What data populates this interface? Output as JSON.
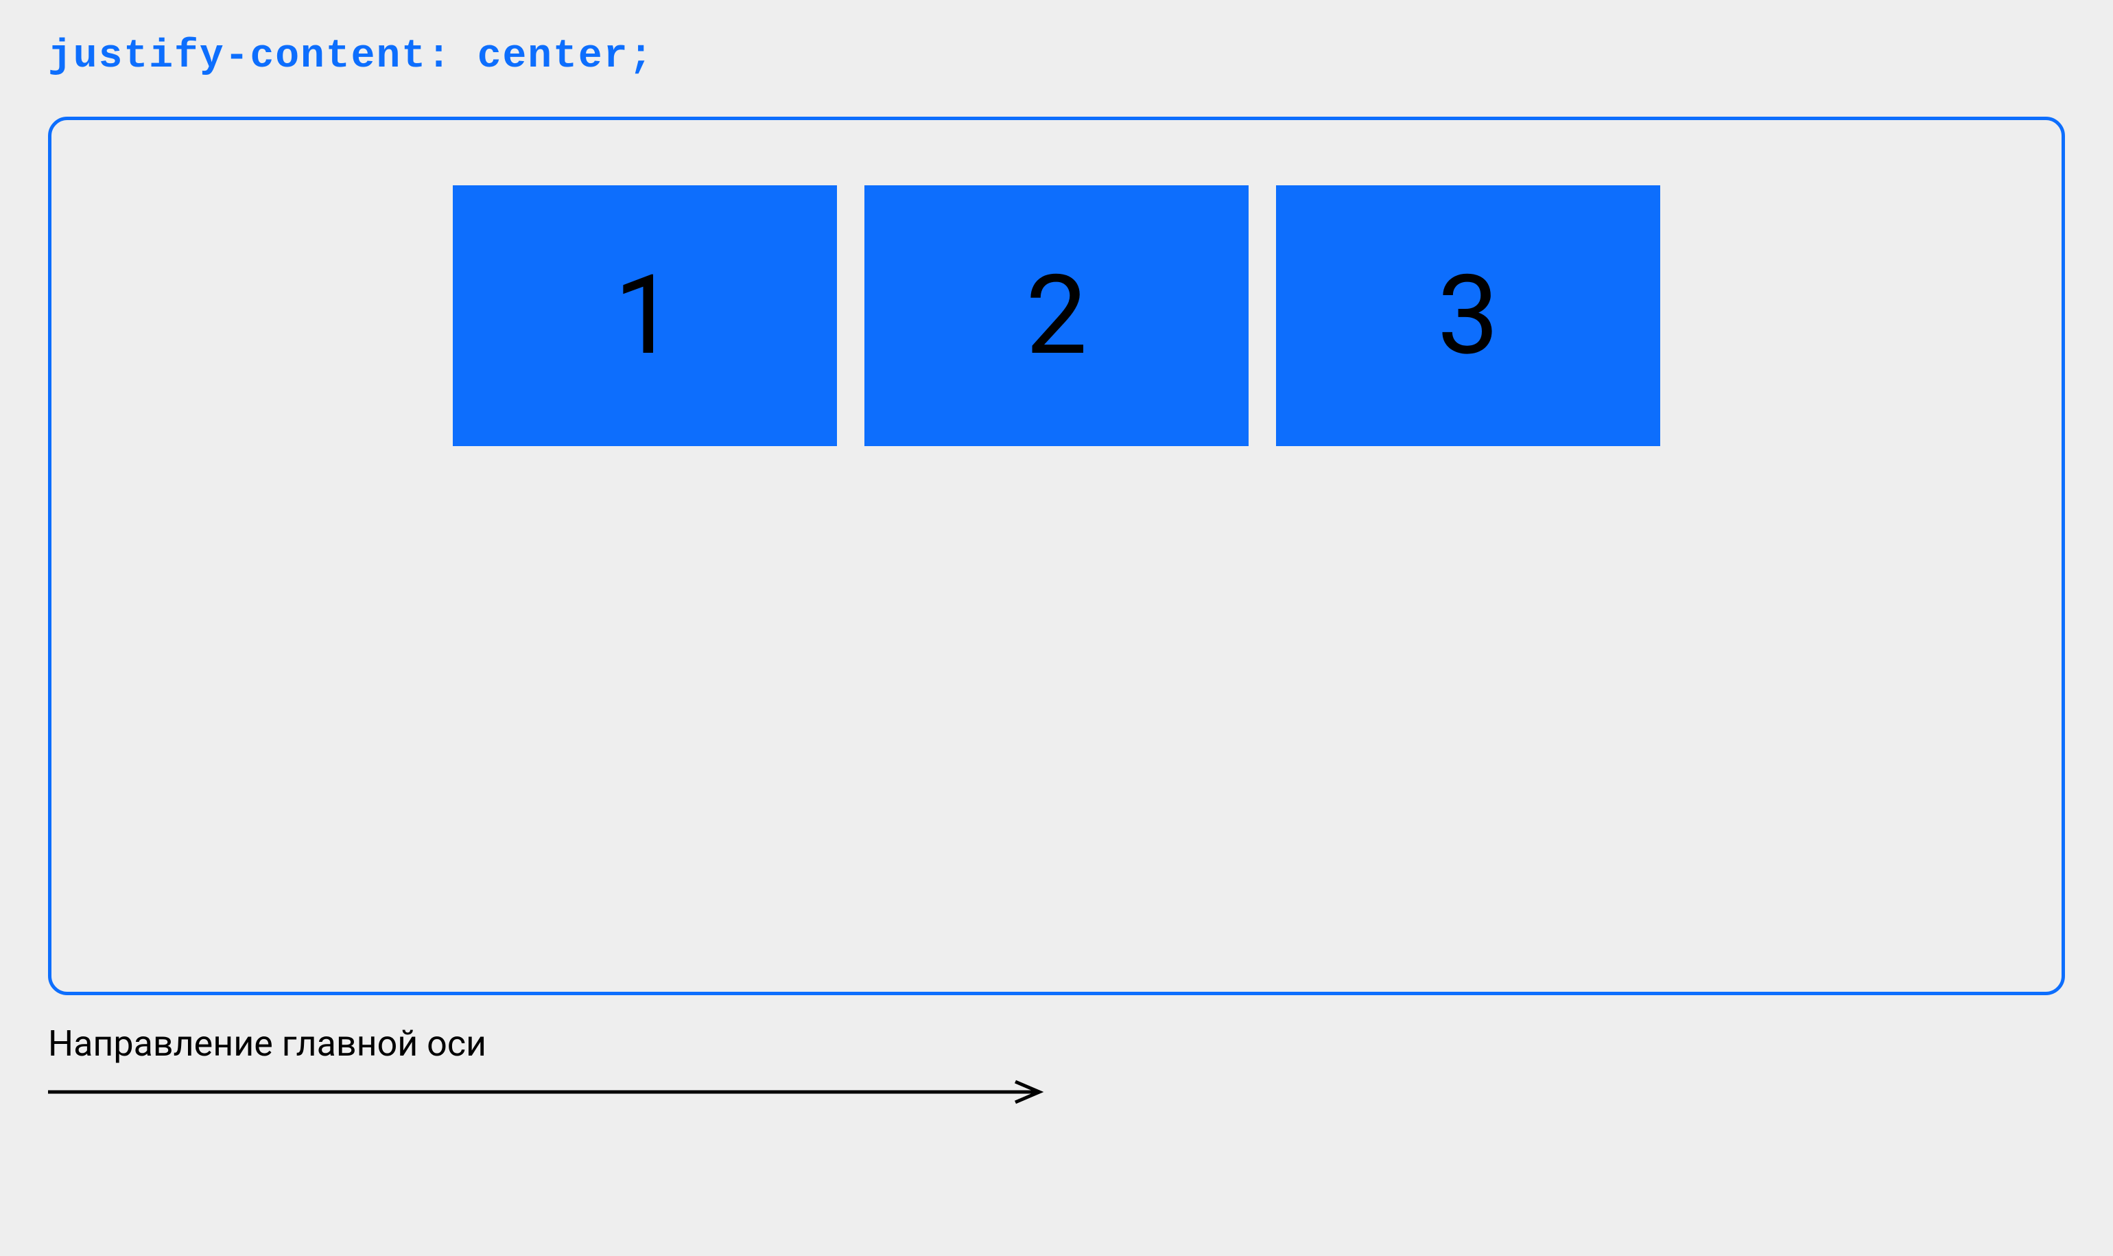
{
  "heading": "justify-content: center;",
  "items": {
    "item1": "1",
    "item2": "2",
    "item3": "3"
  },
  "axis_label": "Направление главной оси",
  "colors": {
    "accent": "#0d6efd",
    "background": "#eeeeee",
    "text": "#000000"
  }
}
